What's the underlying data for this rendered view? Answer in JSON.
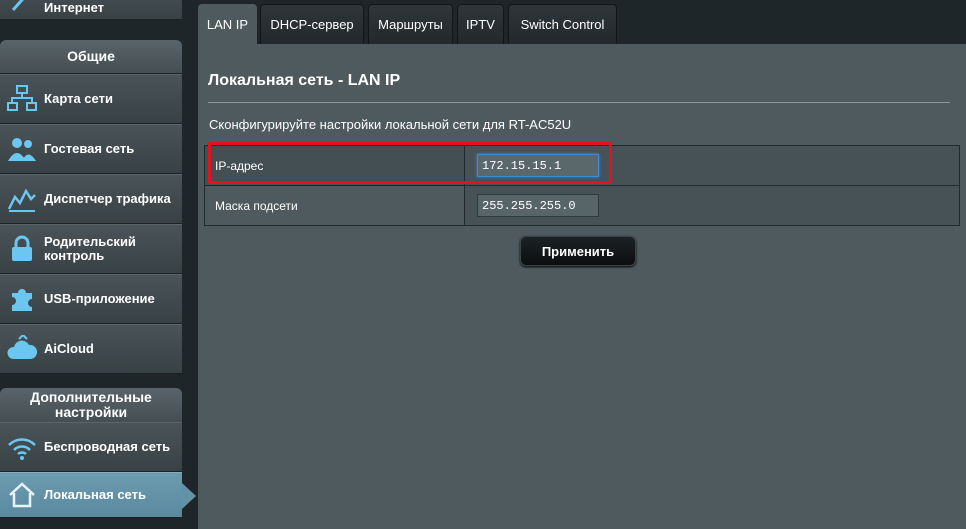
{
  "sidebar": {
    "top_item": {
      "label": "Интернет",
      "icon": "globe-icon"
    },
    "general_header": "Общие",
    "general_items": [
      {
        "label": "Карта сети",
        "icon": "network-map-icon"
      },
      {
        "label": "Гостевая сеть",
        "icon": "guest-network-icon"
      },
      {
        "label": "Диспетчер трафика",
        "icon": "traffic-manager-icon"
      },
      {
        "label": "Родительский контроль",
        "icon": "lock-icon"
      },
      {
        "label": "USB-приложение",
        "icon": "puzzle-icon"
      },
      {
        "label": "AiCloud",
        "icon": "cloud-icon"
      }
    ],
    "advanced_header": "Дополнительные настройки",
    "advanced_items": [
      {
        "label": "Беспроводная сеть",
        "icon": "wifi-icon"
      },
      {
        "label": "Локальная сеть",
        "icon": "home-icon",
        "active": true
      }
    ]
  },
  "tabs": [
    {
      "label": "LAN IP",
      "active": true
    },
    {
      "label": "DHCP-сервер"
    },
    {
      "label": "Маршруты"
    },
    {
      "label": "IPTV"
    },
    {
      "label": "Switch Control"
    }
  ],
  "main": {
    "title": "Локальная сеть - LAN IP",
    "description": "Сконфигурируйте настройки локальной сети для RT-AC52U",
    "fields": [
      {
        "label": "IP-адрес",
        "value": "172.15.15.1"
      },
      {
        "label": "Маска подсети",
        "value": "255.255.255.0"
      }
    ],
    "apply_label": "Применить"
  },
  "colors": {
    "accent_active": "#6391a6",
    "highlight": "#e0141e",
    "focus": "#3b8ad6"
  }
}
